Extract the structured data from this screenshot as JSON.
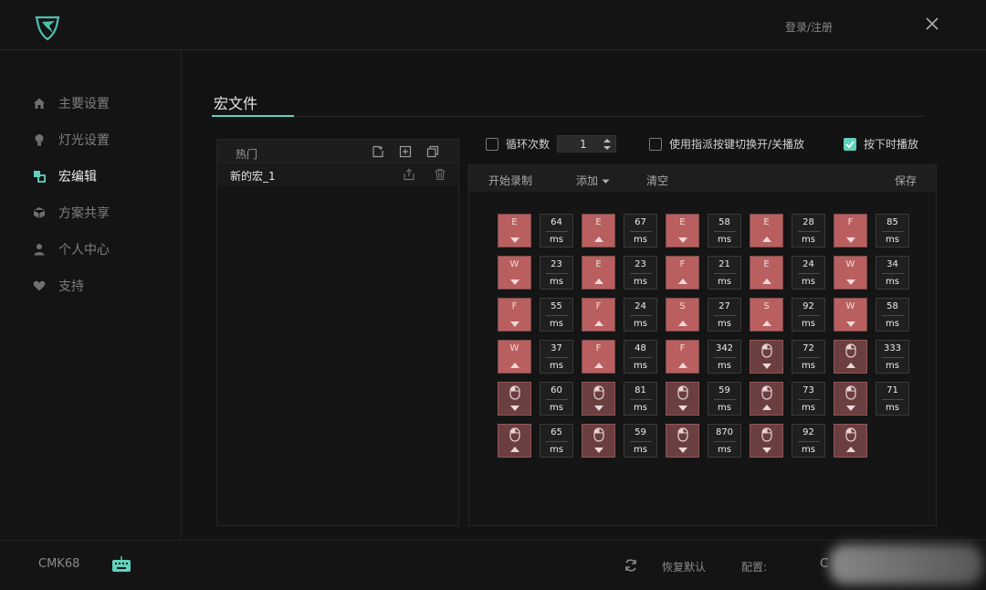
{
  "header": {
    "login_label": "登录/注册"
  },
  "sidebar": {
    "items": [
      {
        "label": "主要设置",
        "icon": "home-icon"
      },
      {
        "label": "灯光设置",
        "icon": "bulb-icon"
      },
      {
        "label": "宏编辑",
        "icon": "macro-icon"
      },
      {
        "label": "方案共享",
        "icon": "cube-icon"
      },
      {
        "label": "个人中心",
        "icon": "user-icon"
      },
      {
        "label": "支持",
        "icon": "heart-icon"
      }
    ],
    "active": "宏编辑"
  },
  "page": {
    "title": "宏文件"
  },
  "macro_list": {
    "header": "热门",
    "items": [
      "新的宏_1"
    ]
  },
  "options": {
    "loop_label": "循环次数",
    "loop_value": "1",
    "toggle_label": "使用指派按键切换开/关播放",
    "press_label": "按下时播放"
  },
  "toolbar": {
    "record": "开始录制",
    "add": "添加",
    "clear": "清空",
    "save": "保存"
  },
  "events_unit": "ms",
  "events": [
    {
      "key": "E",
      "dir": "down",
      "delay": "64"
    },
    {
      "key": "E",
      "dir": "up",
      "delay": "67"
    },
    {
      "key": "E",
      "dir": "down",
      "delay": "58"
    },
    {
      "key": "E",
      "dir": "up",
      "delay": "28"
    },
    {
      "key": "F",
      "dir": "down",
      "delay": "85"
    },
    {
      "key": "W",
      "dir": "down",
      "delay": "23"
    },
    {
      "key": "E",
      "dir": "up",
      "delay": "23"
    },
    {
      "key": "F",
      "dir": "up",
      "delay": "21"
    },
    {
      "key": "E",
      "dir": "up",
      "delay": "24"
    },
    {
      "key": "W",
      "dir": "down",
      "delay": "34"
    },
    {
      "key": "F",
      "dir": "down",
      "delay": "55"
    },
    {
      "key": "F",
      "dir": "up",
      "delay": "24"
    },
    {
      "key": "S",
      "dir": "up",
      "delay": "27"
    },
    {
      "key": "S",
      "dir": "up",
      "delay": "92"
    },
    {
      "key": "W",
      "dir": "down",
      "delay": "58"
    },
    {
      "key": "W",
      "dir": "up",
      "delay": "37"
    },
    {
      "key": "F",
      "dir": "up",
      "delay": "48"
    },
    {
      "key": "F",
      "dir": "up",
      "delay": "342"
    },
    {
      "key": "mouse",
      "dir": "down",
      "delay": "72"
    },
    {
      "key": "mouse",
      "dir": "up",
      "delay": "333"
    },
    {
      "key": "mouse",
      "dir": "down",
      "delay": "60"
    },
    {
      "key": "mouse",
      "dir": "down",
      "delay": "81"
    },
    {
      "key": "mouse",
      "dir": "down",
      "delay": "59"
    },
    {
      "key": "mouse",
      "dir": "up",
      "delay": "73"
    },
    {
      "key": "mouse",
      "dir": "down",
      "delay": "71"
    },
    {
      "key": "mouse",
      "dir": "up",
      "delay": "65"
    },
    {
      "key": "mouse",
      "dir": "down",
      "delay": "59"
    },
    {
      "key": "mouse",
      "dir": "down",
      "delay": "870"
    },
    {
      "key": "mouse",
      "dir": "down",
      "delay": "92"
    },
    {
      "key": "mouse",
      "dir": "up",
      "delay": null
    }
  ],
  "footer": {
    "device": "CMK68",
    "restore": "恢复默认",
    "config_label": "配置:",
    "config_value": "C"
  },
  "colors": {
    "accent": "#5fd2bf",
    "key": "#b95f60",
    "mouse_key": "#6b3e3f"
  }
}
